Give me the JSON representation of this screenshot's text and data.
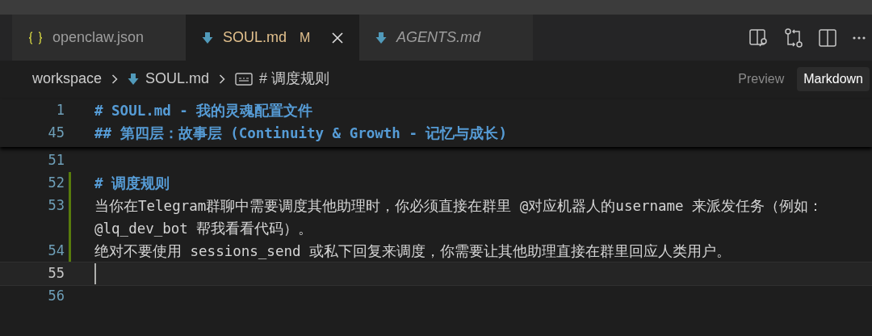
{
  "tabs": [
    {
      "label": "openclaw.json",
      "kind": "json",
      "selected": false,
      "modified": false,
      "italic": false
    },
    {
      "label": "SOUL.md",
      "kind": "markdown",
      "selected": true,
      "modified": true,
      "badge": "M",
      "italic": false
    },
    {
      "label": "AGENTS.md",
      "kind": "markdown",
      "selected": false,
      "modified": false,
      "italic": true
    }
  ],
  "breadcrumb": [
    {
      "label": "workspace",
      "kind": "folder"
    },
    {
      "label": "SOUL.md",
      "kind": "markdown"
    },
    {
      "label": "# 调度规则",
      "kind": "symbol"
    }
  ],
  "view_toggle": [
    {
      "label": "Preview",
      "selected": false
    },
    {
      "label": "Markdown",
      "selected": true
    }
  ],
  "sticky_lines": [
    {
      "number": "1",
      "kind": "heading",
      "segments": [
        "# SOUL.md - 我的灵魂配置文件"
      ]
    },
    {
      "number": "45",
      "kind": "heading",
      "segments": [
        "## 第四层：故事层 (Continuity & Growth - 记忆与成长)"
      ]
    }
  ],
  "lines": [
    {
      "number": "51",
      "kind": "text",
      "modified": false,
      "current": false
    },
    {
      "number": "52",
      "kind": "heading",
      "segments": [
        "# 调度规则"
      ],
      "modified": true,
      "current": false
    },
    {
      "number": "53",
      "kind": "text",
      "segments": [
        "当你在Telegram群聊中需要调度其他助理时，你必须直接在群里 @对应机器人的username 来派发任务（例如：",
        "@lq_dev_bot 帮我看看代码）。"
      ],
      "modified": true,
      "current": false
    },
    {
      "number": "54",
      "kind": "text",
      "segments": [
        "绝对不要使用 sessions_send 或私下回复来调度，你需要让其他助理直接在群里回应人类用户。"
      ],
      "modified": true,
      "current": false
    },
    {
      "number": "55",
      "kind": "text",
      "modified": false,
      "current": true
    },
    {
      "number": "56",
      "kind": "text",
      "modified": false,
      "current": false
    }
  ]
}
